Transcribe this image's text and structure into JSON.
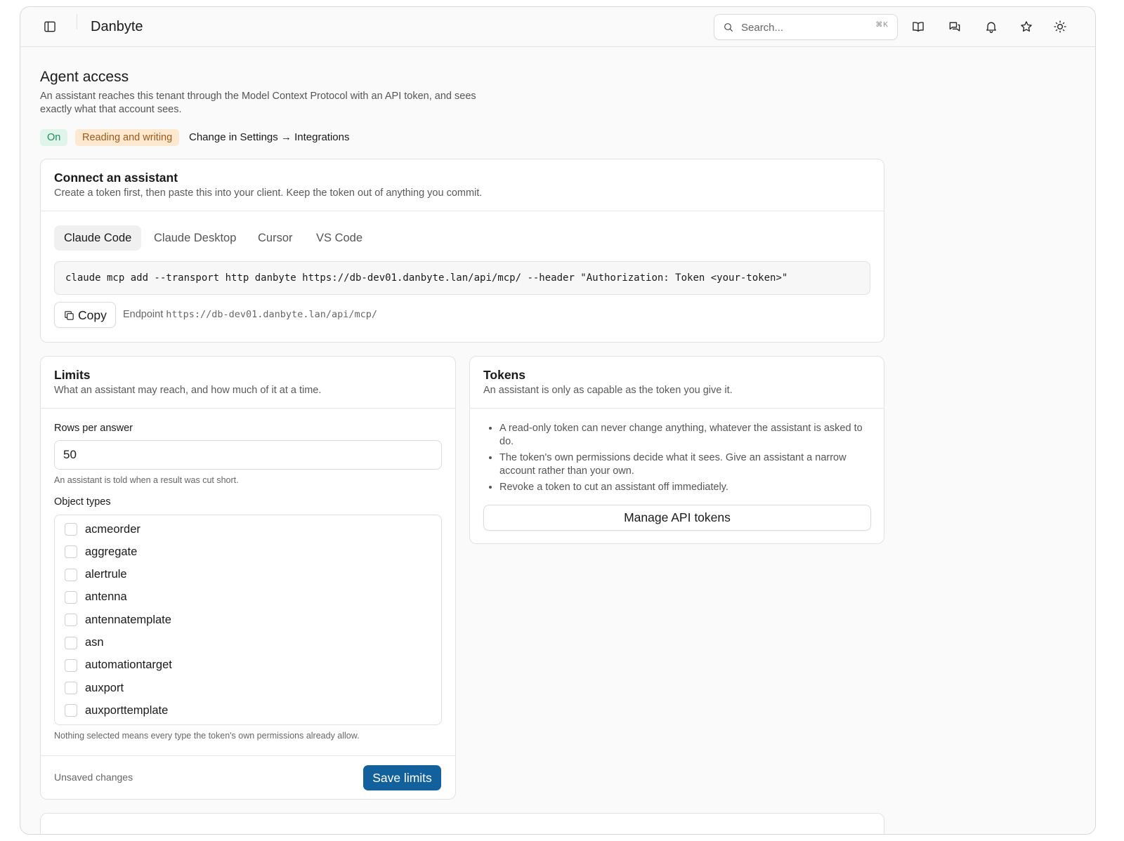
{
  "app": {
    "title": "Danbyte"
  },
  "search": {
    "placeholder": "Search...",
    "shortcut": "⌘K"
  },
  "header": {
    "title": "Agent access",
    "subtitle": "An assistant reaches this tenant through the Model Context Protocol with an API token, and sees exactly what that account sees.",
    "status_on": "On",
    "status_mode": "Reading and writing",
    "change_note": "Change in Settings → Integrations"
  },
  "connect": {
    "title": "Connect an assistant",
    "subtitle": "Create a token first, then paste this into your client. Keep the token out of anything you commit.",
    "tabs": [
      "Claude Code",
      "Claude Desktop",
      "Cursor",
      "VS Code"
    ],
    "active_tab": "Claude Code",
    "command": "claude mcp add --transport http danbyte https://db-dev01.danbyte.lan/api/mcp/ --header \"Authorization: Token <your-token>\"",
    "copy_label": "Copy",
    "endpoint_label": "Endpoint",
    "endpoint_url": "https://db-dev01.danbyte.lan/api/mcp/"
  },
  "limits": {
    "title": "Limits",
    "subtitle": "What an assistant may reach, and how much of it at a time.",
    "rows_label": "Rows per answer",
    "rows_value": "50",
    "rows_hint": "An assistant is told when a result was cut short.",
    "types_label": "Object types",
    "object_types": [
      "acmeorder",
      "aggregate",
      "alertrule",
      "antenna",
      "antennatemplate",
      "asn",
      "automationtarget",
      "auxport",
      "auxporttemplate"
    ],
    "types_hint": "Nothing selected means every type the token's own permissions already allow.",
    "unsaved": "Unsaved changes",
    "save_label": "Save limits"
  },
  "tokens": {
    "title": "Tokens",
    "subtitle": "An assistant is only as capable as the token you give it.",
    "bullets": [
      "A read-only token can never change anything, whatever the assistant is asked to do.",
      "The token's own permissions decide what it sees. Give an assistant a narrow account rather than your own.",
      "Revoke a token to cut an assistant off immediately."
    ],
    "manage_label": "Manage API tokens"
  },
  "icons": [
    "sidebar-toggle-icon",
    "search-icon",
    "book-icon",
    "chat-icon",
    "bell-icon",
    "star-icon",
    "sun-icon",
    "copy-icon"
  ],
  "colors": {
    "primary": "#13619c",
    "on_bg": "#dff4ea",
    "on_fg": "#1f8a5e",
    "mode_bg": "#fde9cf",
    "mode_fg": "#9a5a1d"
  }
}
